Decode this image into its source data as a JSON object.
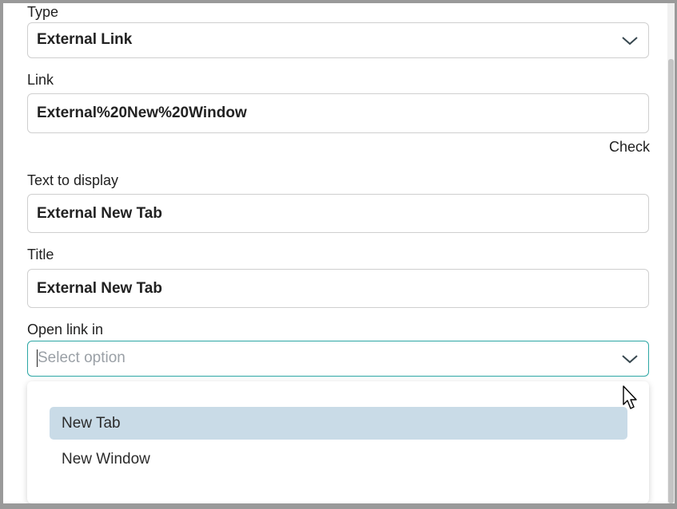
{
  "form": {
    "type": {
      "label": "Type",
      "value": "External Link"
    },
    "link": {
      "label": "Link",
      "value": "External%20New%20Window",
      "check_label": "Check"
    },
    "text_to_display": {
      "label": "Text to display",
      "value": "External New Tab"
    },
    "title": {
      "label": "Title",
      "value": "External New Tab"
    },
    "open_link_in": {
      "label": "Open link in",
      "placeholder": "Select option",
      "options": [
        "New Tab",
        "New Window"
      ],
      "highlighted_option": "New Tab"
    }
  },
  "icons": {
    "dropdown_chevron": "chevron-down-icon",
    "mouse_cursor": "pointer-cursor-icon"
  },
  "colors": {
    "focus_border": "#2ca6a4",
    "option_highlight": "#c9dbe7",
    "field_border": "#cfcfcf"
  }
}
